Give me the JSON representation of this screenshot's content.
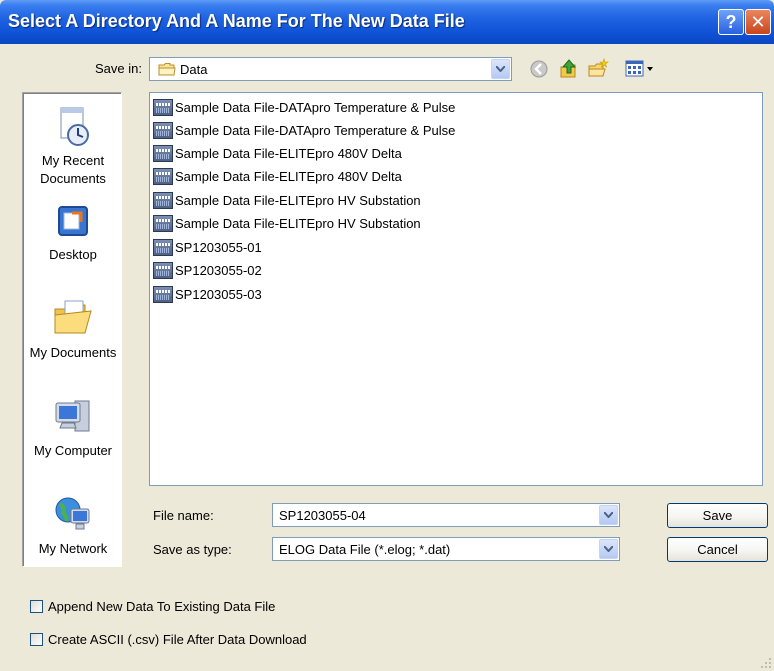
{
  "window": {
    "title": "Select A Directory And A Name For The New Data File",
    "help_label": "?",
    "close_label": "✕"
  },
  "save_in": {
    "label": "Save in:",
    "value": "Data"
  },
  "toolbar": {
    "icons": [
      "back-icon",
      "up-folder-icon",
      "new-folder-icon",
      "view-menu-icon"
    ]
  },
  "places": [
    {
      "label_lines": [
        "My Recent",
        "Documents"
      ],
      "icon": "recent-documents-icon"
    },
    {
      "label_lines": [
        "Desktop"
      ],
      "icon": "desktop-icon"
    },
    {
      "label_lines": [
        "My Documents"
      ],
      "icon": "my-documents-icon"
    },
    {
      "label_lines": [
        "My Computer"
      ],
      "icon": "my-computer-icon"
    },
    {
      "label_lines": [
        "My Network"
      ],
      "icon": "my-network-icon"
    }
  ],
  "files": [
    "Sample Data File-DATApro Temperature & Pulse",
    "Sample Data File-DATApro Temperature & Pulse",
    "Sample Data File-ELITEpro 480V Delta",
    "Sample Data File-ELITEpro 480V Delta",
    "Sample Data File-ELITEpro HV Substation",
    "Sample Data File-ELITEpro HV Substation",
    "SP1203055-01",
    "SP1203055-02",
    "SP1203055-03"
  ],
  "file_name": {
    "label": "File name:",
    "value": "SP1203055-04"
  },
  "save_as_type": {
    "label": "Save as type:",
    "value": "ELOG Data File (*.elog; *.dat)"
  },
  "buttons": {
    "save": "Save",
    "cancel": "Cancel"
  },
  "options": {
    "append": {
      "label": "Append New Data To Existing Data File",
      "checked": false
    },
    "ascii": {
      "label": "Create ASCII (.csv) File After Data Download",
      "checked": false
    }
  }
}
